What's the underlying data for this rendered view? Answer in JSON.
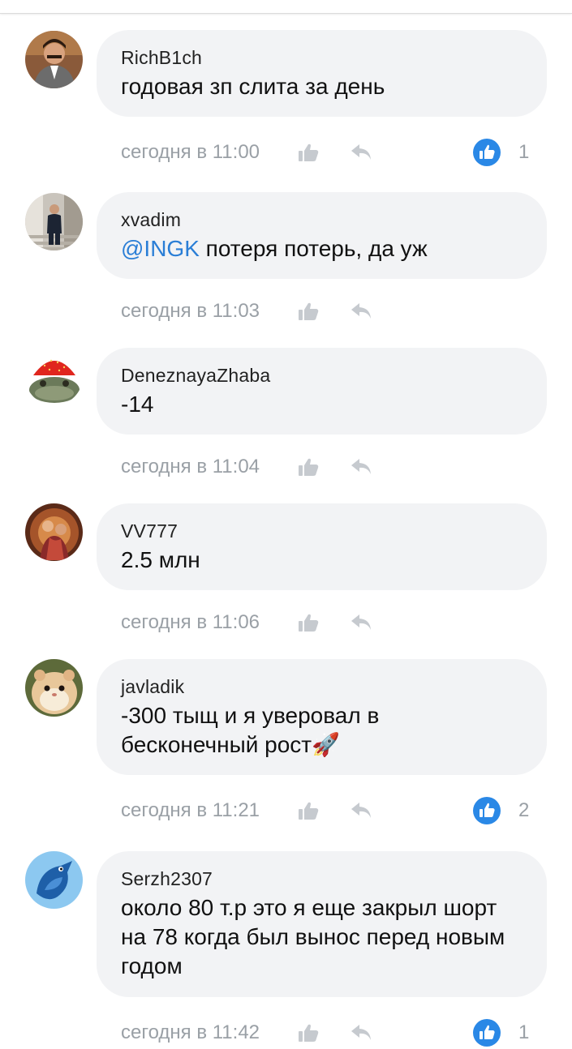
{
  "accent_color": "#2a88e6",
  "comments": [
    {
      "author": "RichB1ch",
      "text": "годовая зп слита за день",
      "time": "сегодня в 11:00",
      "likes": "1",
      "avatar_icon": "man-in-suit-avatar"
    },
    {
      "author": "xvadim",
      "mention": "@INGK",
      "text": " потеря потерь, да уж",
      "time": "сегодня в 11:03",
      "avatar_icon": "man-on-stairs-avatar"
    },
    {
      "author": "DeneznayaZhaba",
      "text": "-14",
      "time": "сегодня в 11:04",
      "avatar_icon": "frog-strawberry-hat-avatar"
    },
    {
      "author": "VV777",
      "text": "2.5 млн",
      "time": "сегодня в 11:06",
      "avatar_icon": "couple-painting-avatar"
    },
    {
      "author": "javladik",
      "text": "-300 тыщ и я уверовал в бесконечный рост🚀",
      "time": "сегодня в 11:21",
      "likes": "2",
      "avatar_icon": "hamster-avatar"
    },
    {
      "author": "Serzh2307",
      "text": "около 80 т.р это я еще закрыл шорт на 78 когда был вынос перед новым годом",
      "time": "сегодня в 11:42",
      "likes": "1",
      "avatar_icon": "blue-bird-avatar"
    }
  ]
}
